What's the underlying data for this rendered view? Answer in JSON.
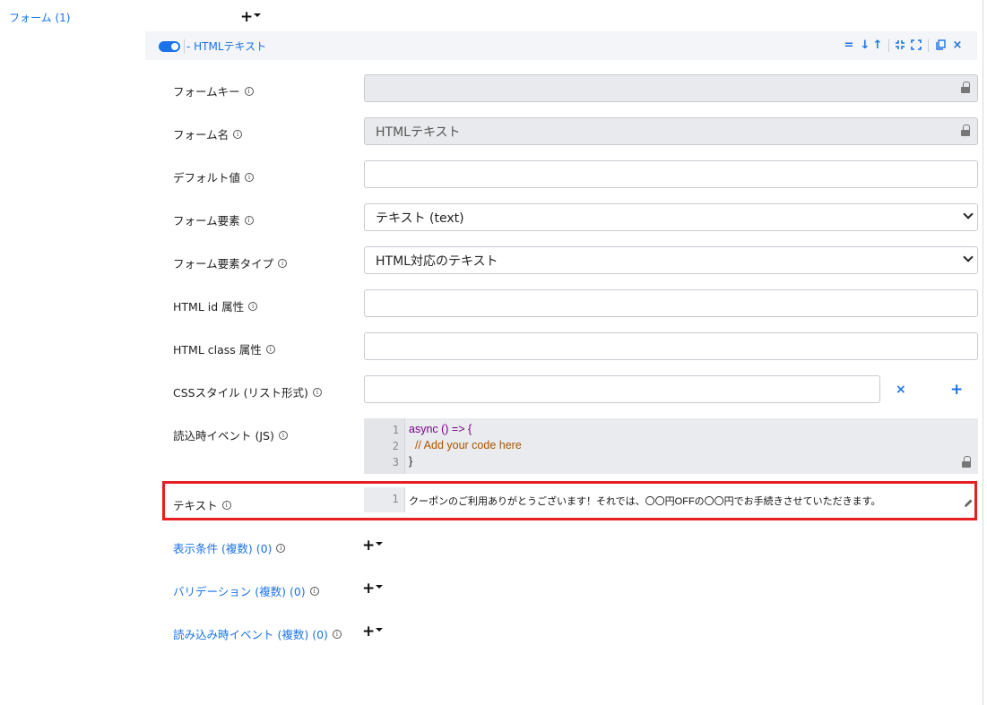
{
  "root": {
    "label": "フォーム (1)"
  },
  "header": {
    "title": "- HTMLテキスト"
  },
  "fields": {
    "form_key": {
      "label": "フォームキー",
      "value": ""
    },
    "form_name": {
      "label": "フォーム名",
      "value": "HTMLテキスト"
    },
    "default_value": {
      "label": "デフォルト値",
      "value": ""
    },
    "form_element": {
      "label": "フォーム要素",
      "value": "テキスト (text)"
    },
    "form_element_type": {
      "label": "フォーム要素タイプ",
      "value": "HTML対応のテキスト"
    },
    "html_id": {
      "label": "HTML id 属性",
      "value": ""
    },
    "html_class": {
      "label": "HTML class 属性",
      "value": ""
    },
    "css_style": {
      "label": "CSSスタイル (リスト形式)",
      "value": ""
    },
    "load_event": {
      "label": "読込時イベント (JS)",
      "code": [
        {
          "n": "1",
          "text": "async () => {"
        },
        {
          "n": "2",
          "text": "  // Add your code here"
        },
        {
          "n": "3",
          "text": "}"
        }
      ]
    },
    "text": {
      "label": "テキスト",
      "line_no": "1",
      "value": "クーポンのご利用ありがとうございます！それでは、〇〇円OFFの〇〇円でお手続きさせていただきます。"
    }
  },
  "sub_sections": {
    "conditions": "表示条件 (複数) (0)",
    "validation": "バリデーション (複数) (0)",
    "load_events": "読み込み時イベント (複数) (0)"
  },
  "icons": {
    "info": "i",
    "plus": "+",
    "remove": "×"
  },
  "colors": {
    "accent": "#1a73e8",
    "highlight": "#e62020",
    "readonly_bg": "#e8eaed"
  }
}
